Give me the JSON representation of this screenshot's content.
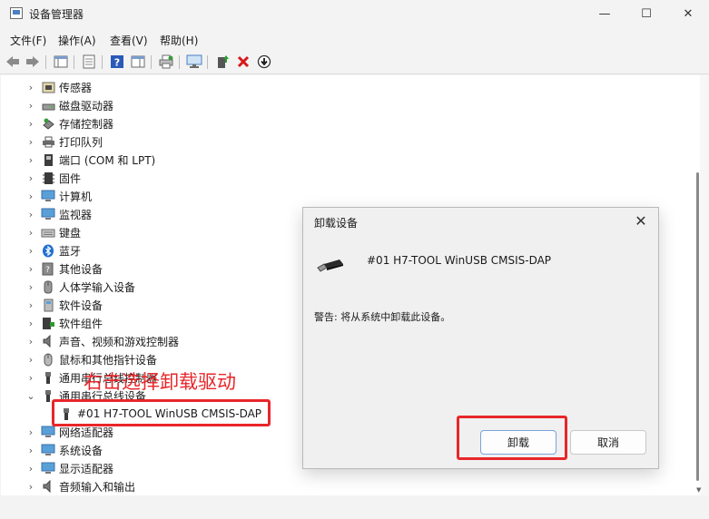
{
  "window": {
    "title": "设备管理器"
  },
  "window_controls": {
    "minimize": "—",
    "maximize": "☐",
    "close": "✕"
  },
  "menu": [
    "文件(F)",
    "操作(A)",
    "查看(V)",
    "帮助(H)"
  ],
  "tree": {
    "items": [
      {
        "label": "传感器",
        "expanded": false,
        "icon": "sensor-icon"
      },
      {
        "label": "磁盘驱动器",
        "expanded": false,
        "icon": "disk-drive-icon"
      },
      {
        "label": "存储控制器",
        "expanded": false,
        "icon": "storage-controller-icon"
      },
      {
        "label": "打印队列",
        "expanded": false,
        "icon": "printer-icon"
      },
      {
        "label": "端口 (COM 和 LPT)",
        "expanded": false,
        "icon": "port-icon"
      },
      {
        "label": "固件",
        "expanded": false,
        "icon": "firmware-icon"
      },
      {
        "label": "计算机",
        "expanded": false,
        "icon": "computer-icon"
      },
      {
        "label": "监视器",
        "expanded": false,
        "icon": "monitor-icon"
      },
      {
        "label": "键盘",
        "expanded": false,
        "icon": "keyboard-icon"
      },
      {
        "label": "蓝牙",
        "expanded": false,
        "icon": "bluetooth-icon"
      },
      {
        "label": "其他设备",
        "expanded": false,
        "icon": "other-devices-icon"
      },
      {
        "label": "人体学输入设备",
        "expanded": false,
        "icon": "hid-icon"
      },
      {
        "label": "软件设备",
        "expanded": false,
        "icon": "software-device-icon"
      },
      {
        "label": "软件组件",
        "expanded": false,
        "icon": "software-component-icon"
      },
      {
        "label": "声音、视频和游戏控制器",
        "expanded": false,
        "icon": "sound-icon"
      },
      {
        "label": "鼠标和其他指针设备",
        "expanded": false,
        "icon": "mouse-icon"
      },
      {
        "label": "通用串行总线控制器",
        "expanded": false,
        "icon": "usb-icon"
      },
      {
        "label": "通用串行总线设备",
        "expanded": true,
        "icon": "usb-icon"
      },
      {
        "label": "#01 H7-TOOL WinUSB CMSIS-DAP",
        "child": true,
        "icon": "usb-plug-icon"
      },
      {
        "label": "网络适配器",
        "expanded": false,
        "icon": "network-adapter-icon"
      },
      {
        "label": "系统设备",
        "expanded": false,
        "icon": "system-device-icon"
      },
      {
        "label": "显示适配器",
        "expanded": false,
        "icon": "display-adapter-icon"
      },
      {
        "label": "音频输入和输出",
        "expanded": false,
        "icon": "audio-io-icon"
      }
    ]
  },
  "annotation": {
    "text": "右击选择卸载驱动",
    "color": "#e8262a"
  },
  "dialog": {
    "title": "卸载设备",
    "device_name": "#01 H7-TOOL WinUSB CMSIS-DAP",
    "warning": "警告: 将从系统中卸载此设备。",
    "uninstall_label": "卸载",
    "cancel_label": "取消",
    "close": "✕"
  },
  "colors": {
    "highlight": "#e8262a",
    "accent": "#4a7fc1"
  }
}
